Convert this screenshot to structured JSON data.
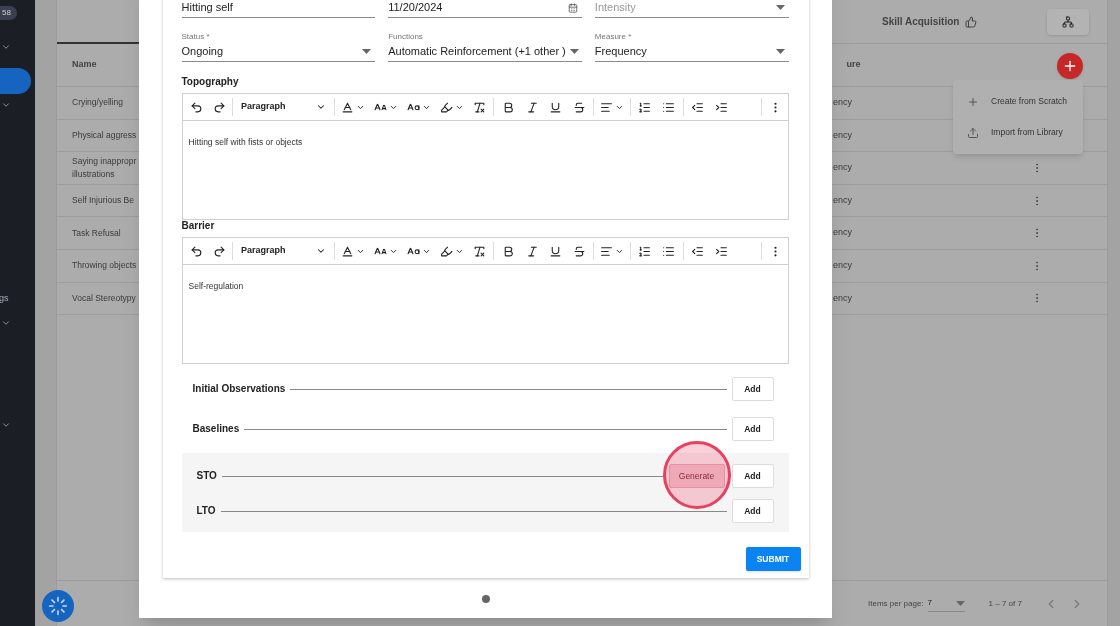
{
  "sidebar": {
    "badge": "58",
    "items": [
      {
        "kind": "group",
        "selected": false
      },
      {
        "kind": "link",
        "selected": true
      },
      {
        "kind": "group",
        "selected": false
      },
      {
        "kind": "group",
        "label": "gs",
        "selected": false
      },
      {
        "kind": "group",
        "selected": false
      }
    ]
  },
  "background_table": {
    "header_title": "Skill Acquisition",
    "columns": [
      "Name",
      "ure"
    ],
    "rows": [
      {
        "name": [
          "Crying/yelling"
        ],
        "measure": "ency"
      },
      {
        "name": [
          "Physical aggress"
        ],
        "measure": "ency"
      },
      {
        "name": [
          "Saying inappropr",
          "illustrations"
        ],
        "measure": "ency"
      },
      {
        "name": [
          "Self Injurious Be"
        ],
        "measure": "ency"
      },
      {
        "name": [
          "Task Refusal"
        ],
        "measure": "ency"
      },
      {
        "name": [
          "Throwing objects"
        ],
        "measure": "ency"
      },
      {
        "name": [
          "Vocal Stereotypy"
        ],
        "measure": "ency"
      }
    ],
    "pagination": {
      "label": "Items per page:",
      "page_size": "7",
      "range": "1 – 7 of 7"
    }
  },
  "add_menu": {
    "items": [
      {
        "kind": "create",
        "label": "Create from Scratch"
      },
      {
        "kind": "import",
        "label": "Import from Library"
      }
    ]
  },
  "form": {
    "fields": [
      {
        "kind": "text",
        "value": "Hitting self"
      },
      {
        "kind": "date",
        "value": "11/20/2024"
      },
      {
        "kind": "select",
        "placeholder": "Intensity"
      },
      {
        "kind": "select",
        "label": "Status *",
        "value": "Ongoing"
      },
      {
        "kind": "select",
        "label": "Functions",
        "value": "Automatic Reinforcement (+1 other )"
      },
      {
        "kind": "select",
        "label": "Measure *",
        "value": "Frequency"
      }
    ],
    "editors": [
      {
        "label": "Topography",
        "block_style": "Paragraph",
        "content": "Hitting self with fists or objects"
      },
      {
        "label": "Barrier",
        "block_style": "Paragraph",
        "content": "Self-regulation"
      }
    ],
    "sections": [
      {
        "shaded": false,
        "rows": [
          {
            "title": "Initial Observations",
            "buttons": [
              {
                "kind": "add",
                "label": "Add",
                "highlighted": false
              }
            ]
          }
        ]
      },
      {
        "shaded": false,
        "rows": [
          {
            "title": "Baselines",
            "buttons": [
              {
                "kind": "add",
                "label": "Add",
                "highlighted": false
              }
            ]
          }
        ]
      },
      {
        "shaded": true,
        "rows": [
          {
            "title": "STO",
            "buttons": [
              {
                "kind": "generate",
                "label": "Generate",
                "highlighted": true
              },
              {
                "kind": "add",
                "label": "Add",
                "highlighted": false
              }
            ]
          },
          {
            "title": "LTO",
            "buttons": [
              {
                "kind": "add",
                "label": "Add",
                "highlighted": false
              }
            ]
          }
        ]
      }
    ],
    "submit": "SUBMIT"
  }
}
